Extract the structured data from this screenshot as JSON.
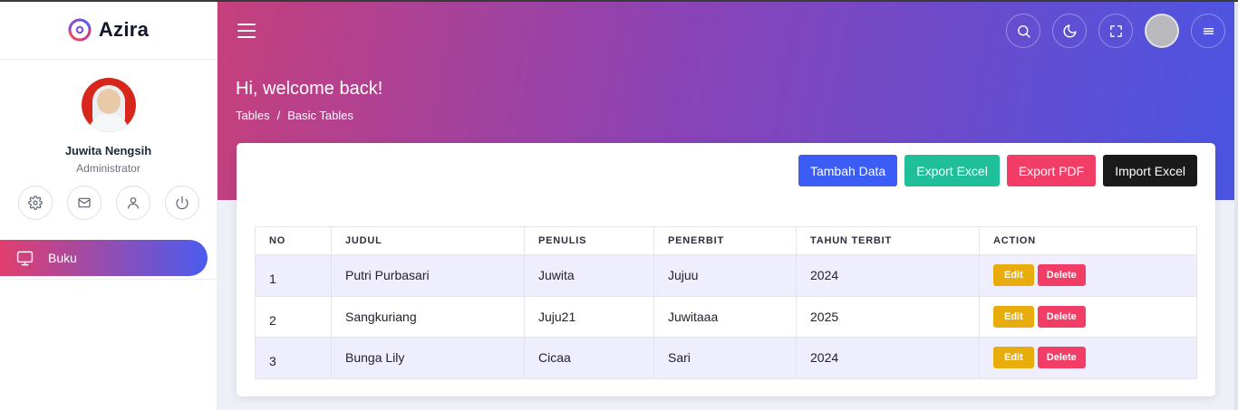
{
  "brand": {
    "name": "Azira"
  },
  "user": {
    "name": "Juwita Nengsih",
    "role": "Administrator"
  },
  "sidebar": {
    "items": [
      {
        "label": "Buku",
        "icon": "monitor-icon"
      }
    ]
  },
  "header": {
    "welcome": "Hi, welcome back!",
    "breadcrumb": [
      "Tables",
      "/",
      "Basic Tables"
    ],
    "icons": [
      "search-icon",
      "moon-icon",
      "fullscreen-icon",
      "avatar",
      "menu-icon"
    ]
  },
  "toolbar": {
    "add_label": "Tambah Data",
    "export_excel_label": "Export Excel",
    "export_pdf_label": "Export PDF",
    "import_excel_label": "Import Excel"
  },
  "table": {
    "headers": [
      "NO",
      "JUDUL",
      "PENULIS",
      "PENERBIT",
      "TAHUN TERBIT",
      "ACTION"
    ],
    "rows": [
      {
        "no": "1",
        "judul": "Putri Purbasari",
        "penulis": "Juwita",
        "penerbit": "Jujuu",
        "tahun": "2024"
      },
      {
        "no": "2",
        "judul": "Sangkuriang",
        "penulis": "Juju21",
        "penerbit": "Juwitaaa",
        "tahun": "2025"
      },
      {
        "no": "3",
        "judul": "Bunga Lily",
        "penulis": "Cicaa",
        "penerbit": "Sari",
        "tahun": "2024"
      }
    ],
    "edit_label": "Edit",
    "delete_label": "Delete"
  },
  "colors": {
    "accent_blue": "#3b5cf5",
    "teal": "#1fbf9a",
    "red": "#f23d66",
    "edit_yellow": "#e8ad0c",
    "gradient_start": "#c6407c",
    "gradient_end": "#4a55e3"
  }
}
